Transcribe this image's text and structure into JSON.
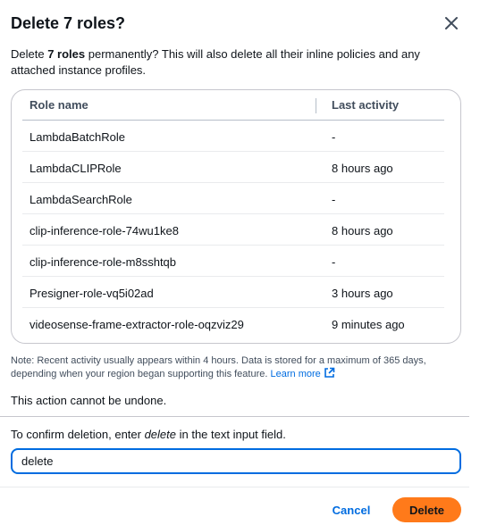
{
  "modal": {
    "title": "Delete 7 roles?",
    "intro_prefix": "Delete ",
    "intro_bold": "7 roles",
    "intro_suffix": " permanently? This will also delete all their inline policies and any attached instance profiles."
  },
  "table": {
    "headers": {
      "name": "Role name",
      "activity": "Last activity"
    },
    "rows": [
      {
        "name": "LambdaBatchRole",
        "activity": "-"
      },
      {
        "name": "LambdaCLIPRole",
        "activity": "8 hours ago"
      },
      {
        "name": "LambdaSearchRole",
        "activity": "-"
      },
      {
        "name": "clip-inference-role-74wu1ke8",
        "activity": "8 hours ago"
      },
      {
        "name": "clip-inference-role-m8sshtqb",
        "activity": "-"
      },
      {
        "name": "Presigner-role-vq5i02ad",
        "activity": "3 hours ago"
      },
      {
        "name": "videosense-frame-extractor-role-oqzviz29",
        "activity": "9 minutes ago"
      }
    ]
  },
  "note": {
    "text": "Note: Recent activity usually appears within 4 hours. Data is stored for a maximum of 365 days, depending when your region began supporting this feature. ",
    "link": "Learn more"
  },
  "warning": "This action cannot be undone.",
  "confirm": {
    "prefix": "To confirm deletion, enter ",
    "keyword": "delete",
    "suffix": " in the text input field.",
    "input_value": "delete"
  },
  "buttons": {
    "cancel": "Cancel",
    "delete": "Delete"
  },
  "colors": {
    "primary": "#ff7a1a",
    "link": "#006ce0",
    "focus": "#006ce0"
  }
}
